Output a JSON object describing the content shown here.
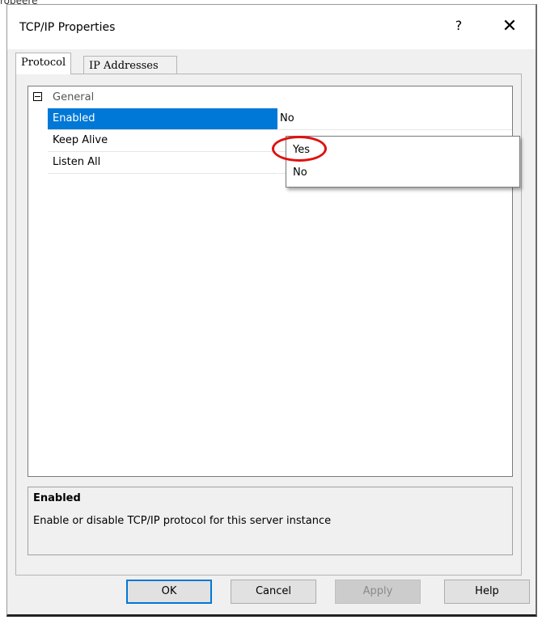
{
  "window": {
    "caption_fragment": "ropeere",
    "title": "TCP/IP Properties",
    "help_glyph": "?",
    "close_glyph": "✕"
  },
  "tabs": [
    {
      "label": "Protocol",
      "active": true
    },
    {
      "label": "IP Addresses",
      "active": false
    }
  ],
  "grid": {
    "category": "General",
    "rows": [
      {
        "label": "Enabled",
        "value": "No",
        "selected": true
      },
      {
        "label": "Keep Alive",
        "value": ""
      },
      {
        "label": "Listen All",
        "value": ""
      }
    ]
  },
  "dropdown": {
    "options": [
      "Yes",
      "No"
    ],
    "highlighted": "Yes"
  },
  "description": {
    "title": "Enabled",
    "text": "Enable or disable TCP/IP protocol for this server instance"
  },
  "buttons": {
    "ok": "OK",
    "cancel": "Cancel",
    "apply": "Apply",
    "help": "Help"
  },
  "colors": {
    "selection": "#0078d7",
    "annotation": "#e01010"
  }
}
